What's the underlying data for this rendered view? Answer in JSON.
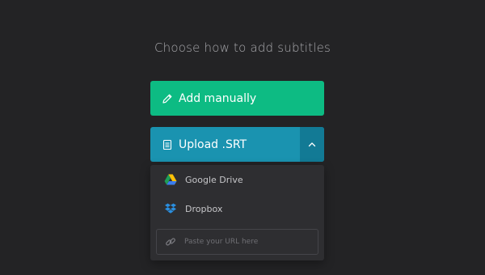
{
  "heading": "Choose how to add subtitles",
  "buttons": {
    "add_manually": "Add manually",
    "upload_srt": "Upload .SRT"
  },
  "dropdown": {
    "items": [
      {
        "label": "Google Drive",
        "icon": "google-drive-icon"
      },
      {
        "label": "Dropbox",
        "icon": "dropbox-icon"
      }
    ],
    "url_input": {
      "placeholder": "Paste your URL here",
      "value": "",
      "icon": "link-icon"
    }
  },
  "colors": {
    "background": "#232325",
    "add_button": "#0dbb83",
    "upload_button": "#1a93b0",
    "upload_toggle": "#127a95",
    "dropdown": "#2e2e31"
  }
}
